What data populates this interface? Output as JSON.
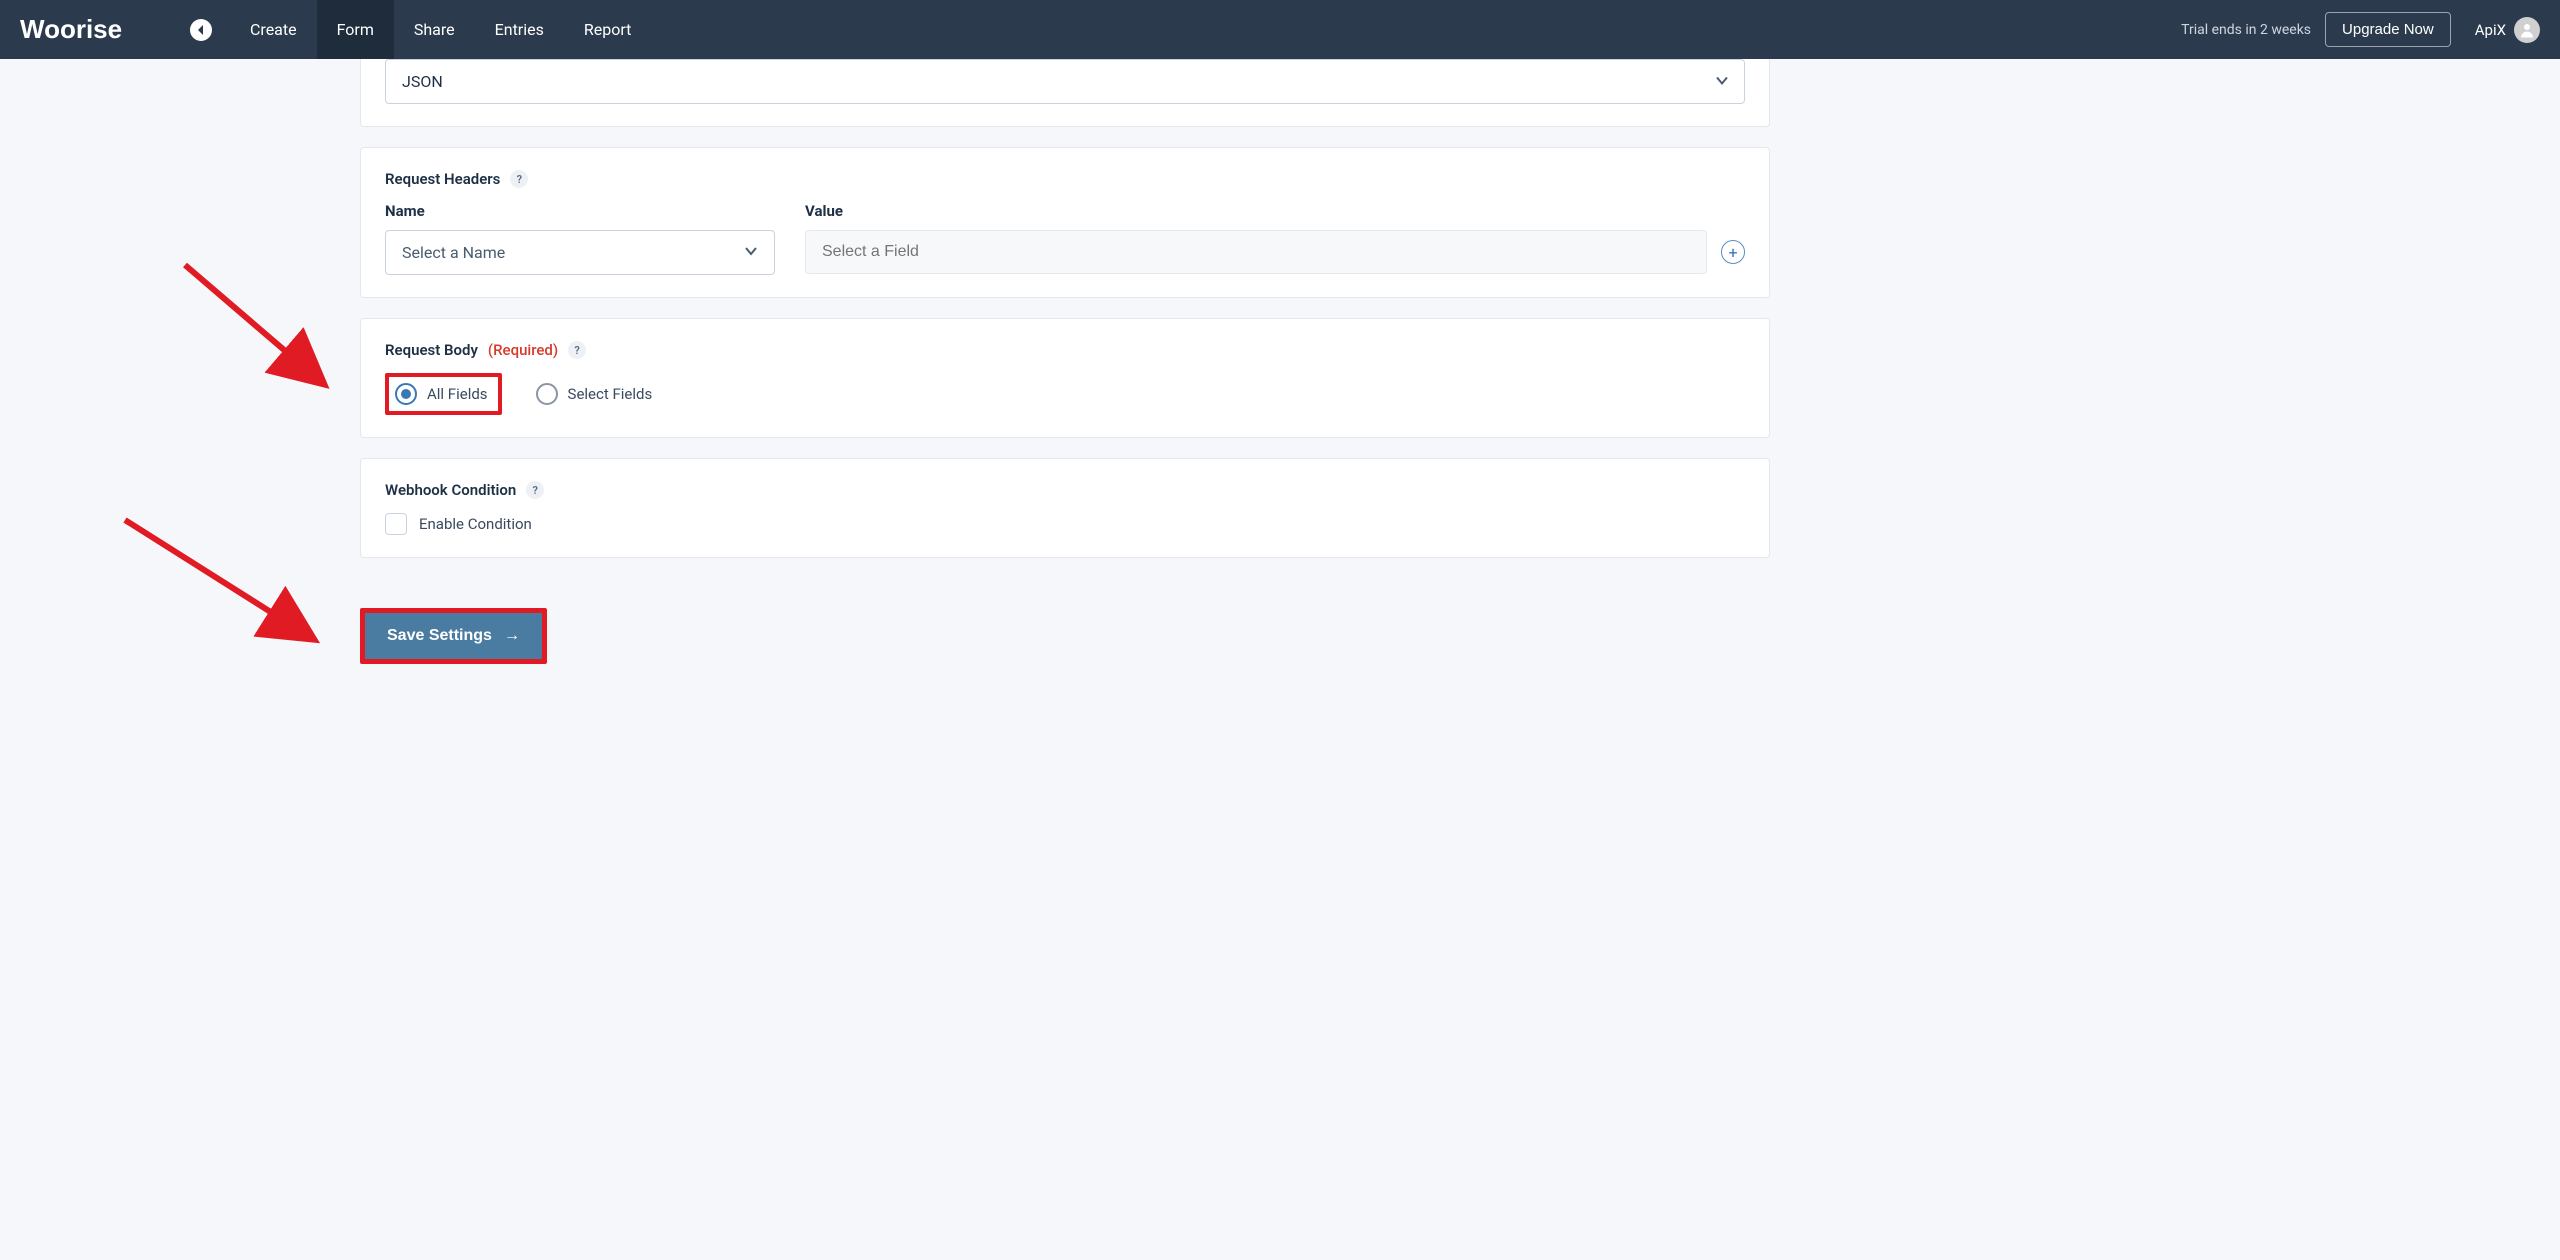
{
  "brand": "Woorise",
  "nav": {
    "items": [
      "Create",
      "Form",
      "Share",
      "Entries",
      "Report"
    ],
    "active_index": 1
  },
  "header": {
    "trial_text": "Trial ends in 2 weeks",
    "upgrade_label": "Upgrade Now",
    "username": "ApiX"
  },
  "format_section": {
    "value": "JSON"
  },
  "request_headers": {
    "title": "Request Headers",
    "name_col": "Name",
    "value_col": "Value",
    "name_placeholder": "Select a Name",
    "value_placeholder": "Select a Field"
  },
  "request_body": {
    "title": "Request Body",
    "required_label": "(Required)",
    "option_all": "All Fields",
    "option_select": "Select Fields"
  },
  "webhook_condition": {
    "title": "Webhook Condition",
    "enable_label": "Enable Condition"
  },
  "save_label": "Save Settings",
  "help_symbol": "?",
  "arrow_symbol": "→",
  "plus_symbol": "+"
}
